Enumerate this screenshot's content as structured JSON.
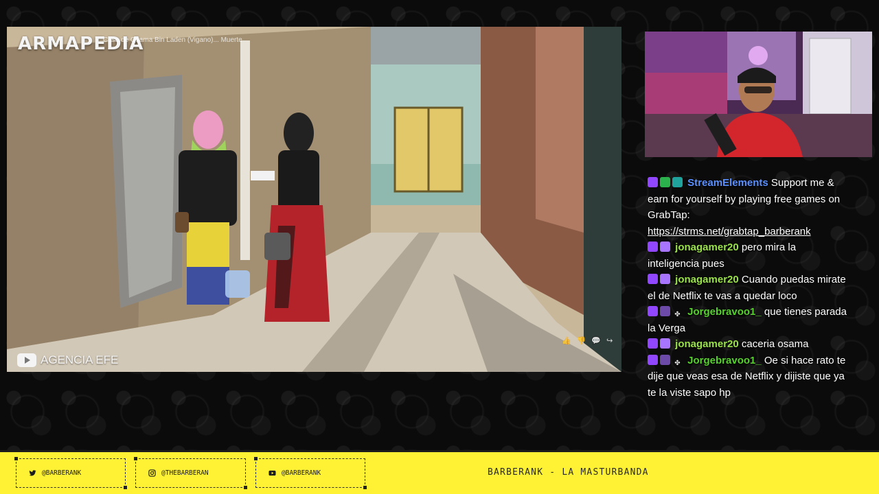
{
  "video": {
    "watermark": "ARMAPEDIA",
    "caption": "Casa de Osama Bin Laden (Vigano)... Muerte",
    "source_label": "AGENCIA EFE",
    "actions": [
      "👍",
      "👎",
      "💬",
      "↪"
    ]
  },
  "chat": {
    "messages": [
      {
        "user": "StreamElements",
        "text": "Support me & earn for yourself by playing free games on GrabTap:",
        "link": "https://strms.net/grabtap_barberank"
      },
      {
        "user": "jonagamer20",
        "text": "pero mira la inteligencia pues"
      },
      {
        "user": "jonagamer20",
        "text": "Cuando puedas mirate el de Netflix te vas a quedar loco"
      },
      {
        "user": "Jorgebravoo1_",
        "text": "que tienes parada la Verga"
      },
      {
        "user": "jonagamer20",
        "text": "caceria osama"
      },
      {
        "user": "Jorgebravoo1_",
        "text": "Oe si hace rato te dije que veas esa de Netflix y dijiste que ya te la viste sapo hp"
      }
    ]
  },
  "footer": {
    "twitter": "@BARBERANK",
    "instagram": "@THEBARBERAN",
    "youtube": "@BARBERANK",
    "title": "BARBERANK - LA MASTURBANDA"
  },
  "colors": {
    "bar": "#fff134",
    "user_streamelements": "#5a90ff",
    "user_jona": "#9be34a",
    "user_jorge": "#57d12f"
  }
}
